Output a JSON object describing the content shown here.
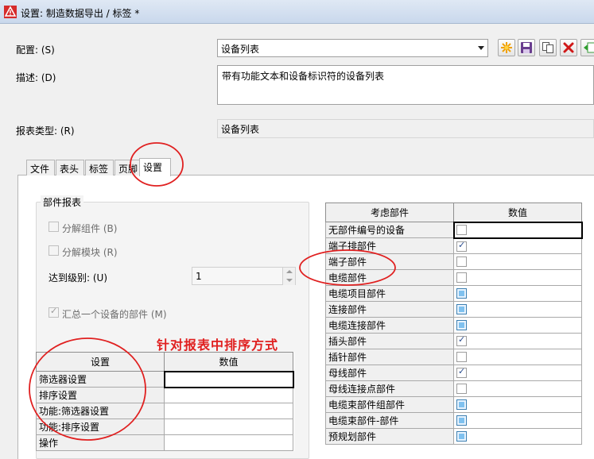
{
  "window": {
    "title": "设置: 制造数据导出 / 标签 *"
  },
  "form": {
    "config_label": "配置: (S)",
    "config_value": "设备列表",
    "description_label": "描述: (D)",
    "description_value": "带有功能文本和设备标识符的设备列表",
    "report_type_label": "报表类型: (R)",
    "report_type_value": "设备列表"
  },
  "toolbar_icons": [
    "new-star-icon",
    "save-icon",
    "copy-icon",
    "delete-icon",
    "import-icon"
  ],
  "tabs": [
    {
      "label": "文件",
      "active": false
    },
    {
      "label": "表头",
      "active": false
    },
    {
      "label": "标签",
      "active": false
    },
    {
      "label": "页脚",
      "active": false
    },
    {
      "label": "设置",
      "active": true
    }
  ],
  "parts_report": {
    "title": "部件报表",
    "split_assembly": {
      "label": "分解组件 (B)",
      "checked": false,
      "enabled": false
    },
    "split_module": {
      "label": "分解模块 (R)",
      "checked": false,
      "enabled": false
    },
    "level_label": "达到级别: (U)",
    "level_value": "1",
    "summarize": {
      "label": "汇总一个设备的部件 (M)",
      "checked": true,
      "enabled": false
    }
  },
  "annotation": "针对报表中排序方式",
  "settings_table": {
    "headers": [
      "设置",
      "数值"
    ],
    "rows": [
      {
        "name": "筛选器设置",
        "value": ""
      },
      {
        "name": "排序设置",
        "value": ""
      },
      {
        "name": "功能:筛选器设置",
        "value": ""
      },
      {
        "name": "功能:排序设置",
        "value": ""
      },
      {
        "name": "操作",
        "value": ""
      }
    ]
  },
  "parts_table": {
    "headers": [
      "考虑部件",
      "数值"
    ],
    "rows": [
      {
        "name": "无部件编号的设备",
        "state": "unchecked"
      },
      {
        "name": "端子排部件",
        "state": "checked"
      },
      {
        "name": "端子部件",
        "state": "unchecked"
      },
      {
        "name": "电缆部件",
        "state": "unchecked"
      },
      {
        "name": "电缆项目部件",
        "state": "indeterminate"
      },
      {
        "name": "连接部件",
        "state": "indeterminate"
      },
      {
        "name": "电缆连接部件",
        "state": "indeterminate"
      },
      {
        "name": "插头部件",
        "state": "checked"
      },
      {
        "name": "插针部件",
        "state": "unchecked"
      },
      {
        "name": "母线部件",
        "state": "checked"
      },
      {
        "name": "母线连接点部件",
        "state": "unchecked"
      },
      {
        "name": "电缆束部件组部件",
        "state": "indeterminate"
      },
      {
        "name": "电缆束部件-部件",
        "state": "indeterminate"
      },
      {
        "name": "预规划部件",
        "state": "indeterminate"
      }
    ]
  },
  "colors": {
    "annotation_red": "#e02020",
    "titlebar": "#c9d8ec",
    "checkbox_blue": "#7fc1ef"
  }
}
